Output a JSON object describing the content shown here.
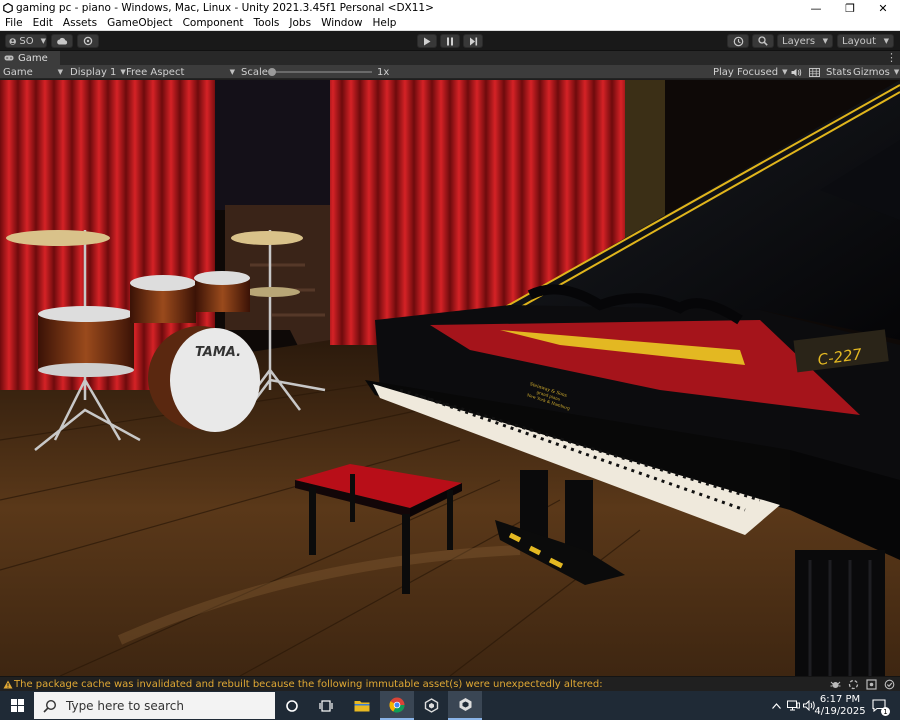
{
  "window": {
    "title": "gaming pc - piano - Windows, Mac, Linux - Unity 2021.3.45f1 Personal <DX11>",
    "minimize_glyph": "—",
    "maximize_glyph": "❐",
    "close_glyph": "✕"
  },
  "menu": [
    "File",
    "Edit",
    "Assets",
    "GameObject",
    "Component",
    "Tools",
    "Jobs",
    "Window",
    "Help"
  ],
  "toolbar": {
    "account_label": "SO",
    "layers_label": "Layers",
    "layout_label": "Layout"
  },
  "panel": {
    "tab_label": "Game",
    "more_glyph": "⋮"
  },
  "game_toolbar": {
    "mode_label": "Game",
    "display_label": "Display 1",
    "aspect_label": "Free Aspect",
    "scale_label": "Scale",
    "scale_value": "1x",
    "scale_slider_fraction": 0,
    "play_mode_label": "Play Focused",
    "stats_label": "Stats",
    "gizmos_label": "Gizmos"
  },
  "scene": {
    "drum_brand": "TAMA.",
    "piano_model": "C-227",
    "piano_maker_line1": "Steinway & Sons",
    "piano_maker_line2": "grand piano",
    "piano_maker_line3": "New York & Hamburg"
  },
  "status": {
    "message": "The package cache was invalidated and rebuilt because the following immutable asset(s) were unexpectedly altered:"
  },
  "taskbar": {
    "search_placeholder": "Type here to search",
    "time": "6:17 PM",
    "date": "4/19/2025"
  },
  "colors": {
    "curtain": "#b3161a",
    "floor": "#3a2412",
    "accent_gold": "#e0b51c",
    "warning": "#e0a834"
  }
}
